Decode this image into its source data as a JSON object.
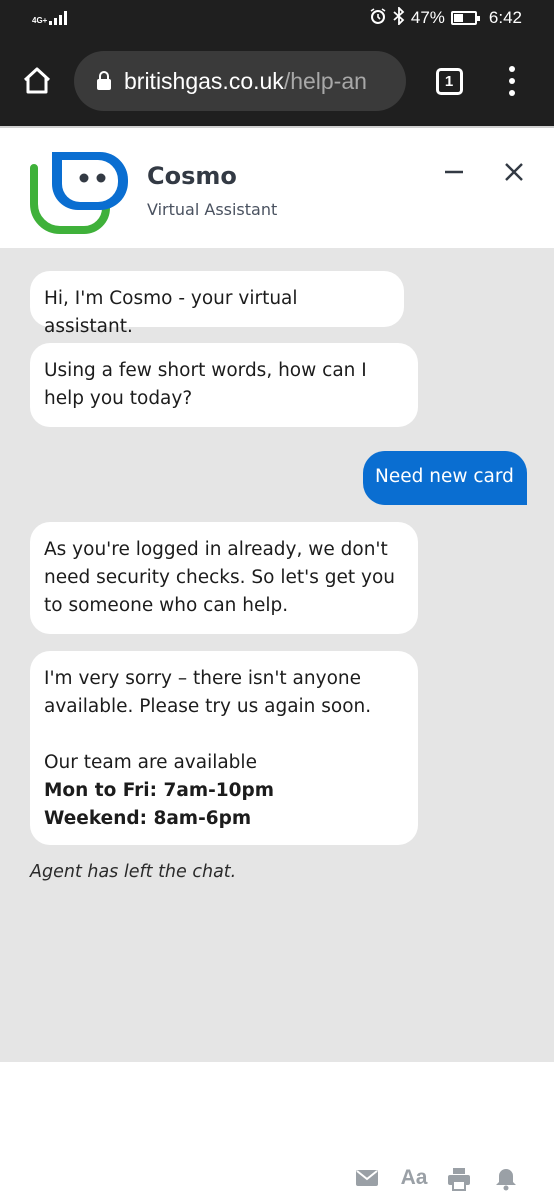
{
  "status_bar": {
    "network": "4G+",
    "battery_percent": "47%",
    "battery_level": 0.47,
    "time": "6:42"
  },
  "browser": {
    "url_host": "britishgas.co.uk",
    "url_path": "/help-an",
    "tab_count": "1"
  },
  "chat_header": {
    "bot_name": "Cosmo",
    "bot_subtitle": "Virtual Assistant"
  },
  "messages": {
    "m1": "Hi, I'm Cosmo - your virtual assistant.",
    "m2": "Using a few short words, how can I help you today?",
    "m3": "Need new card",
    "m4": "As you're logged in already, we don't need security checks. So let's get you to someone who can help.",
    "m5_line1": "I'm very sorry – there isn't anyone available. Please try us again soon.",
    "m5_line2": "Our team are available",
    "m5_line3": "Mon to Fri: 7am-10pm",
    "m5_line4": "Weekend: 8am-6pm"
  },
  "system_note": "Agent has left the chat.",
  "toolbar": {
    "font_label": "Aa"
  },
  "colors": {
    "user_bubble": "#0a6ed1",
    "chat_background": "#e5e5e5",
    "brand_blue": "#0a6ed1",
    "brand_green": "#3fb13a"
  },
  "icons": [
    "alarm-icon",
    "bluetooth-icon",
    "home-icon",
    "lock-icon",
    "menu-icon",
    "minimize-icon",
    "close-icon",
    "mail-icon",
    "print-icon",
    "bell-icon"
  ]
}
